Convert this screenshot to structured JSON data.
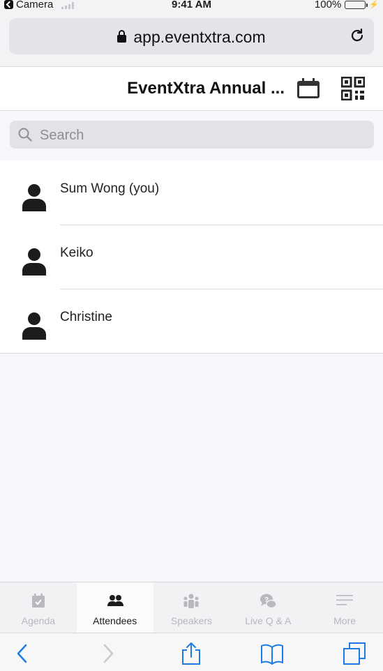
{
  "status": {
    "carrier": "Camera",
    "time": "9:41 AM",
    "battery": "100%"
  },
  "browser": {
    "url": "app.eventxtra.com"
  },
  "header": {
    "title": "EventXtra Annual ..."
  },
  "search": {
    "placeholder": "Search"
  },
  "attendees": [
    {
      "name": "Sum Wong (you)"
    },
    {
      "name": "Keiko"
    },
    {
      "name": "Christine"
    }
  ],
  "tabs": [
    {
      "label": "Agenda",
      "icon": "agenda-icon",
      "active": false
    },
    {
      "label": "Attendees",
      "icon": "attendees-icon",
      "active": true
    },
    {
      "label": "Speakers",
      "icon": "speakers-icon",
      "active": false
    },
    {
      "label": "Live Q & A",
      "icon": "qa-icon",
      "active": false
    },
    {
      "label": "More",
      "icon": "menu-icon",
      "active": false
    }
  ],
  "colors": {
    "accent": "#1c7be5",
    "active_tab": "#1c1c1e",
    "inactive_tab": "#b8b8bd"
  }
}
